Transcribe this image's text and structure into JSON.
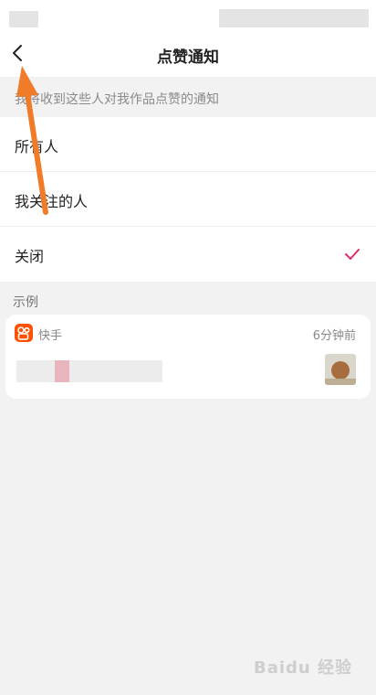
{
  "nav": {
    "title": "点赞通知"
  },
  "hint": {
    "text": "我将收到这些人对我作品点赞的通知"
  },
  "options": [
    {
      "label": "所有人",
      "selected": false
    },
    {
      "label": "我关注的人",
      "selected": false
    },
    {
      "label": "关闭",
      "selected": true
    }
  ],
  "example": {
    "label": "示例",
    "app_name": "快手",
    "time": "6分钟前"
  },
  "colors": {
    "accent": "#e02e5a",
    "app_icon": "#ff5000",
    "annotation_arrow": "#f07c2a"
  },
  "watermark": {
    "text": "Baidu 经验"
  }
}
